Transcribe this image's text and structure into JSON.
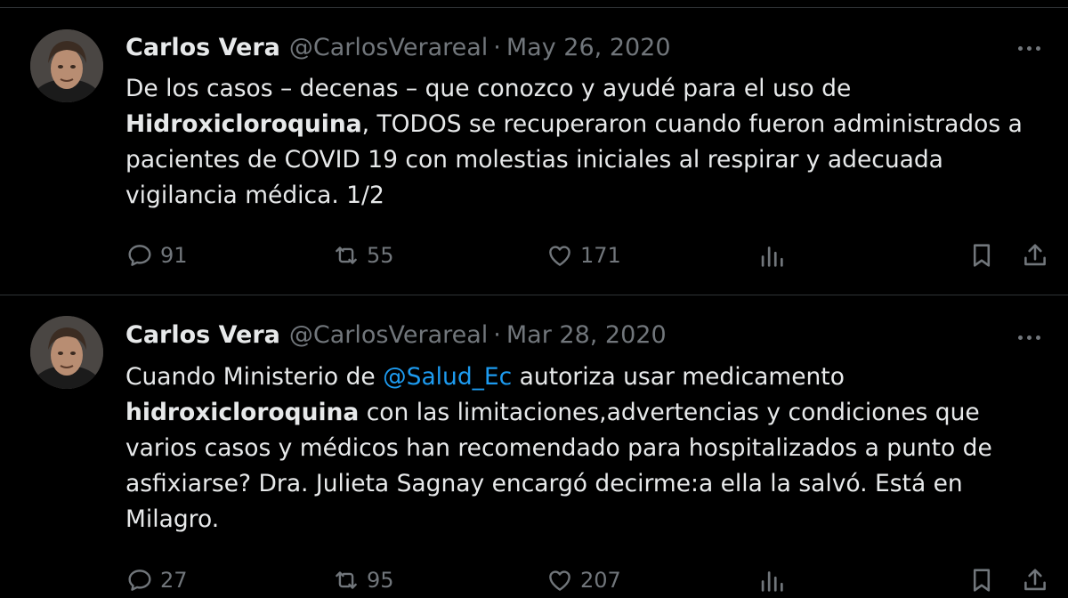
{
  "tweets": [
    {
      "author_name": "Carlos Vera",
      "handle": "@CarlosVerareal",
      "separator": "·",
      "date": "May 26, 2020",
      "text_before": "De los casos – decenas – que conozco y ayudé para el uso de ",
      "text_bold": "Hidroxicloroquina",
      "text_after": ", TODOS se recuperaron cuando fueron administrados a pacientes de COVID 19 con molestias iniciales al respirar y adecuada vigilancia médica. 1/2",
      "replies": "91",
      "retweets": "55",
      "likes": "171"
    },
    {
      "author_name": "Carlos Vera",
      "handle": "@CarlosVerareal",
      "separator": "·",
      "date": "Mar 28, 2020",
      "text_before": "Cuando Ministerio de ",
      "mention": "@Salud_Ec",
      "text_mid": " autoriza usar medicamento ",
      "text_bold": "hidroxicloroquina",
      "text_after": " con las limitaciones,advertencias y condiciones que varios casos y médicos han recomendado para hospitalizados a punto de asfixiarse? Dra. Julieta Sagnay encargó decirme:a ella la salvó. Está en Milagro.",
      "replies": "27",
      "retweets": "95",
      "likes": "207"
    }
  ],
  "icons": {
    "reply": "reply-icon",
    "retweet": "retweet-icon",
    "like": "heart-icon",
    "views": "views-icon",
    "bookmark": "bookmark-icon",
    "share": "share-icon",
    "more": "more-icon"
  },
  "colors": {
    "background": "#000000",
    "text": "#e7e9ea",
    "muted": "#71767b",
    "link": "#1d9bf0",
    "divider": "#2f3336"
  }
}
